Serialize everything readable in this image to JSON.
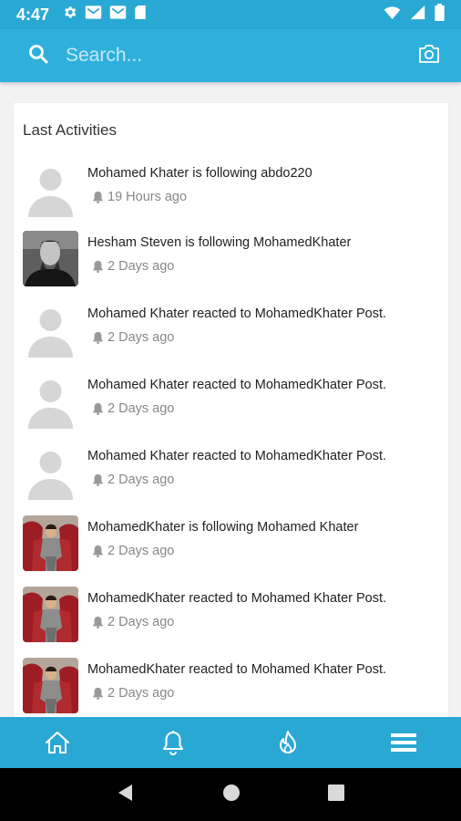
{
  "status_bar": {
    "time": "4:47",
    "icons_left": [
      "gear-icon",
      "mail-icon",
      "mail-icon",
      "sd-card-icon"
    ],
    "icons_right": [
      "wifi-icon",
      "signal-icon",
      "battery-icon"
    ]
  },
  "search": {
    "placeholder": "Search...",
    "icon": "search-icon",
    "camera_icon": "camera-icon"
  },
  "activities": {
    "title": "Last Activities",
    "items": [
      {
        "text": "Mohamed Khater is following abdo220",
        "time": "19 Hours ago",
        "avatar": "placeholder"
      },
      {
        "text": "Hesham Steven is following MohamedKhater",
        "time": "2 Days ago",
        "avatar": "photo-bw"
      },
      {
        "text": "Mohamed Khater reacted to MohamedKhater Post.",
        "time": "2 Days ago",
        "avatar": "placeholder"
      },
      {
        "text": "Mohamed Khater reacted to MohamedKhater Post.",
        "time": "2 Days ago",
        "avatar": "placeholder"
      },
      {
        "text": "Mohamed Khater reacted to MohamedKhater Post.",
        "time": "2 Days ago",
        "avatar": "placeholder"
      },
      {
        "text": "MohamedKhater is following Mohamed Khater",
        "time": "2 Days ago",
        "avatar": "photo-color"
      },
      {
        "text": "MohamedKhater reacted to Mohamed Khater Post.",
        "time": "2 Days ago",
        "avatar": "photo-color"
      },
      {
        "text": "MohamedKhater reacted to Mohamed Khater Post.",
        "time": "2 Days ago",
        "avatar": "photo-color"
      }
    ]
  },
  "bottom_nav": {
    "items": [
      "home-icon",
      "bell-icon",
      "fire-icon",
      "menu-icon"
    ]
  },
  "colors": {
    "primary": "#2aa8d4",
    "card_bg": "#ffffff",
    "page_bg": "#f2f2f2"
  }
}
